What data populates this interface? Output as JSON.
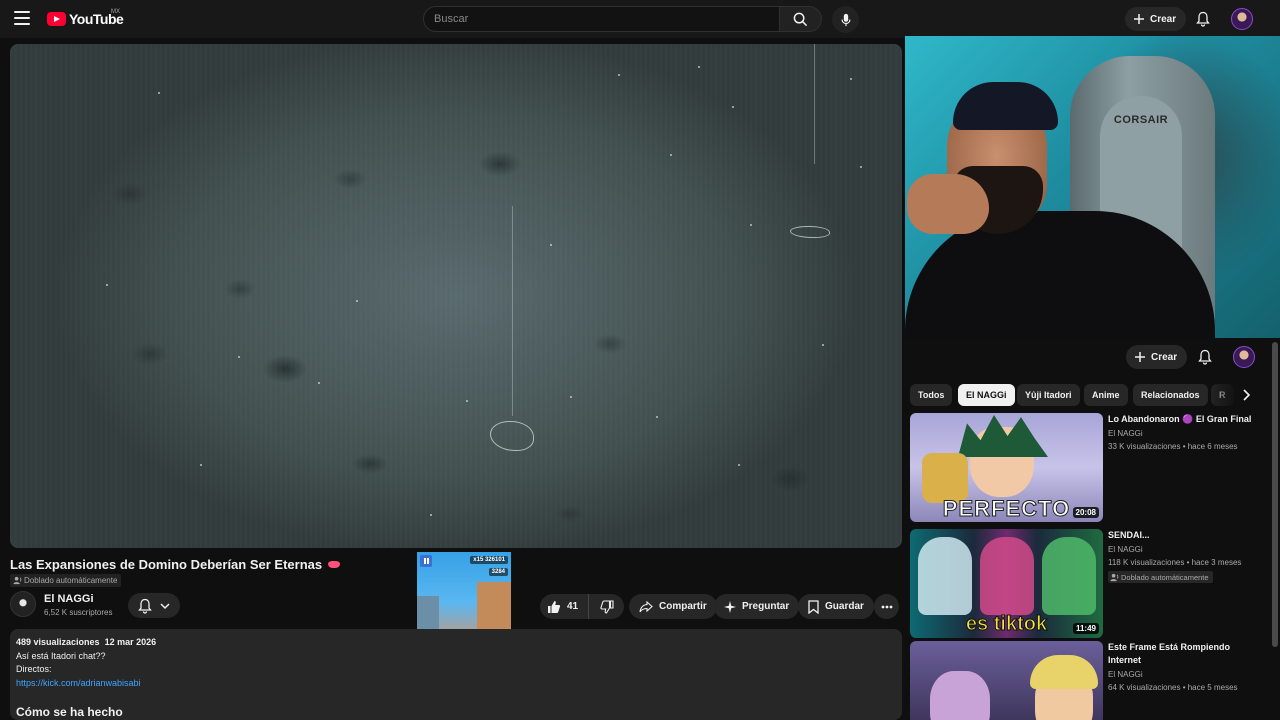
{
  "topbar": {
    "logo_text": "YouTube",
    "region": "MX",
    "search_placeholder": "Buscar",
    "create_label": "Crear"
  },
  "video": {
    "title": "Las Expansiones de Domino Deberían Ser Eternas",
    "dub_badge": "Doblado automáticamente",
    "channel_name": "El NAGGi",
    "subscribers": "6,52 K suscriptores",
    "likes": "41",
    "share_label": "Compartir",
    "ask_label": "Preguntar",
    "save_label": "Guardar"
  },
  "short": {
    "score": "326101",
    "coins": "3284",
    "multiplier": "x15"
  },
  "description": {
    "views": "489 visualizaciones",
    "date": "12 mar 2026",
    "line1": "Así está Itadori chat??",
    "line2": "Directos:",
    "link": "https://kick.com/adrianwabisabi",
    "heading": "Cómo se ha hecho"
  },
  "facecam": {
    "chair_brand": "CORSAIR"
  },
  "sidebar": {
    "create_label": "Crear",
    "chips": [
      "Todos",
      "El NAGGi",
      "Yûji Itadori",
      "Anime",
      "Relacionados",
      "R"
    ],
    "recommendations": [
      {
        "title": "Lo Abandonaron 🟣 El Gran Final",
        "channel": "El NAGGi",
        "meta": "33 K visualizaciones • hace 6 meses",
        "duration": "20:08",
        "thumb_text": "PERFECTO"
      },
      {
        "title": "SENDAI...",
        "channel": "El NAGGi",
        "meta": "118 K visualizaciones • hace 3 meses",
        "badge": "Doblado automáticamente",
        "duration": "11:49",
        "thumb_text": "es tiktok"
      },
      {
        "title": "Este Frame Está Rompiendo Internet",
        "channel": "El NAGGi",
        "meta": "64 K visualizaciones • hace 5 meses"
      }
    ]
  }
}
